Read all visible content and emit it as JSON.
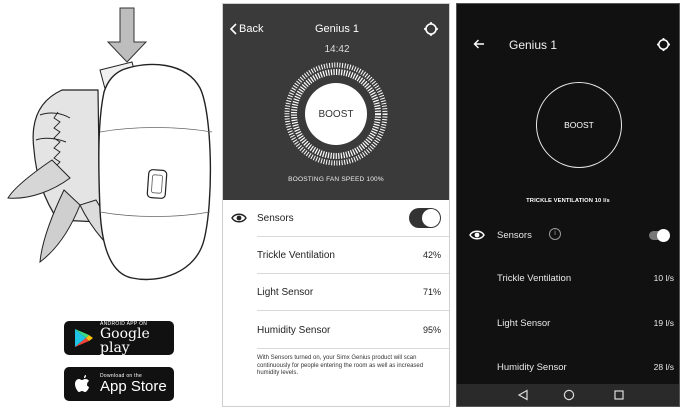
{
  "badges": {
    "google_play": {
      "small": "ANDROID APP ON",
      "big": "Google play"
    },
    "app_store": {
      "small": "Download on the",
      "big": "App Store"
    }
  },
  "phone_ios": {
    "back_label": "Back",
    "title": "Genius 1",
    "time": "14:42",
    "boost_label": "BOOST",
    "status": "BOOSTING FAN SPEED 100%",
    "sensors_label": "Sensors",
    "sensors_on": true,
    "rows": [
      {
        "label": "Trickle Ventilation",
        "value": "42%"
      },
      {
        "label": "Light Sensor",
        "value": "71%"
      },
      {
        "label": "Humidity Sensor",
        "value": "95%"
      }
    ],
    "note": "With Sensors turned on, your Simx Genius product will scan continuously for people entering the room as well as increased humidity levels."
  },
  "phone_android": {
    "title": "Genius 1",
    "boost_label": "BOOST",
    "status": "TRICKLE VENTILATION 10 l/s",
    "sensors_label": "Sensors",
    "info_label": "i",
    "sensors_on": true,
    "rows": [
      {
        "label": "Trickle Ventilation",
        "value": "10 l/s"
      },
      {
        "label": "Light Sensor",
        "value": "19 l/s"
      },
      {
        "label": "Humidity Sensor",
        "value": "28 l/s"
      }
    ]
  },
  "icons": [
    "arrow-down-icon",
    "back-chevron-icon",
    "settings-icon",
    "eye-icon",
    "info-icon",
    "android-back-icon",
    "android-home-icon",
    "android-recents-icon",
    "google-play-logo-icon",
    "apple-logo-icon"
  ],
  "colors": {
    "ios_header": "#3a3a3a",
    "android_bg": "#111111",
    "toggle_on": "#333333"
  }
}
